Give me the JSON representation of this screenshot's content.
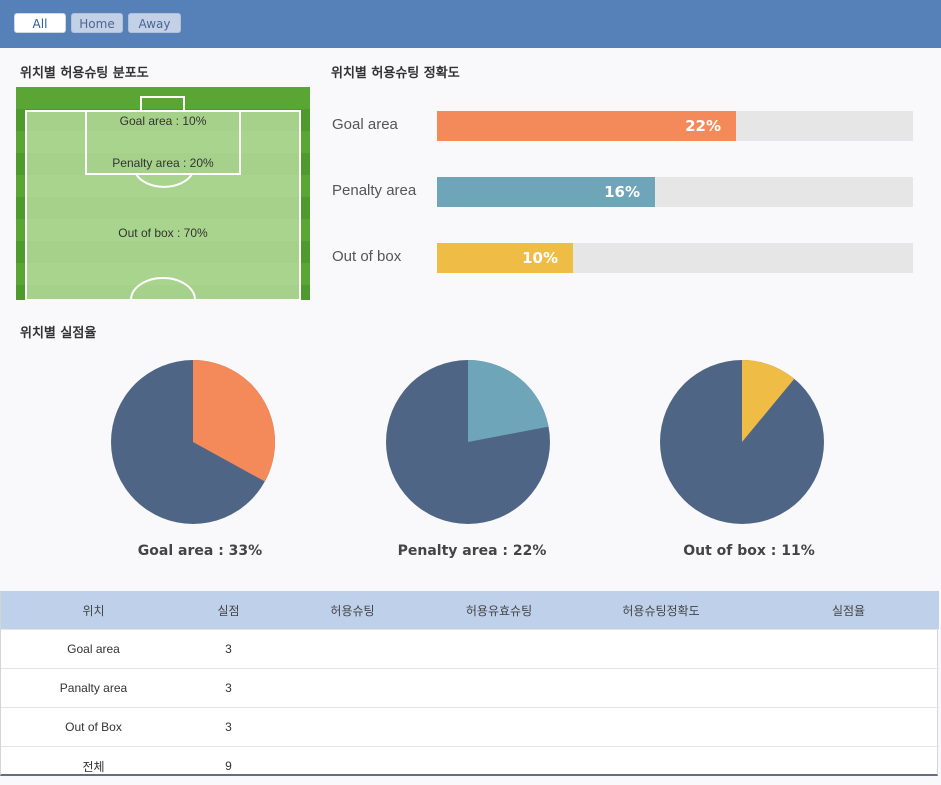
{
  "tabs": [
    {
      "label": "All",
      "active": true
    },
    {
      "label": "Home",
      "active": false
    },
    {
      "label": "Away",
      "active": false
    }
  ],
  "sections": {
    "distribution_title": "위치별 허용슈팅 분포도",
    "accuracy_title": "위치별 허용슈팅 정확도",
    "concede_title": "위치별 실점율"
  },
  "pitch_labels": {
    "goal_area": "Goal area : 10%",
    "penalty_area": "Penalty area : 20%",
    "out_of_box": "Out of box : 70%"
  },
  "chart_data": [
    {
      "type": "pie",
      "title": "위치별 허용슈팅 분포도",
      "categories": [
        "Goal area",
        "Penalty area",
        "Out of box"
      ],
      "values": [
        10,
        20,
        70
      ]
    },
    {
      "type": "bar",
      "title": "위치별 허용슈팅 정확도",
      "categories": [
        "Goal area",
        "Penalty area",
        "Out of box"
      ],
      "values": [
        22,
        16,
        10
      ],
      "value_labels": [
        "22%",
        "16%",
        "10%"
      ],
      "colors": [
        "#f4895a",
        "#6fa5b8",
        "#efbc45"
      ],
      "ylim": [
        0,
        35
      ]
    },
    {
      "type": "pie",
      "title": "위치별 실점율",
      "pies": [
        {
          "caption": "Goal area : 33%",
          "value": 33,
          "color": "#f4895a"
        },
        {
          "caption": "Penalty area : 22%",
          "value": 22,
          "color": "#6fa5b8"
        },
        {
          "caption": "Out of box : 11%",
          "value": 11,
          "color": "#efbc45"
        }
      ],
      "rest_color": "#4f6585"
    }
  ],
  "table": {
    "headers": [
      "위치",
      "실점",
      "허용슈팅",
      "허용유효슈팅",
      "허용슈팅정확도",
      "실점율"
    ],
    "rows": [
      [
        "Goal area",
        "3",
        "",
        "",
        "",
        ""
      ],
      [
        "Panalty area",
        "3",
        "",
        "",
        "",
        ""
      ],
      [
        "Out of Box",
        "3",
        "",
        "",
        "",
        ""
      ],
      [
        "전체",
        "9",
        "",
        "",
        "",
        ""
      ]
    ]
  }
}
